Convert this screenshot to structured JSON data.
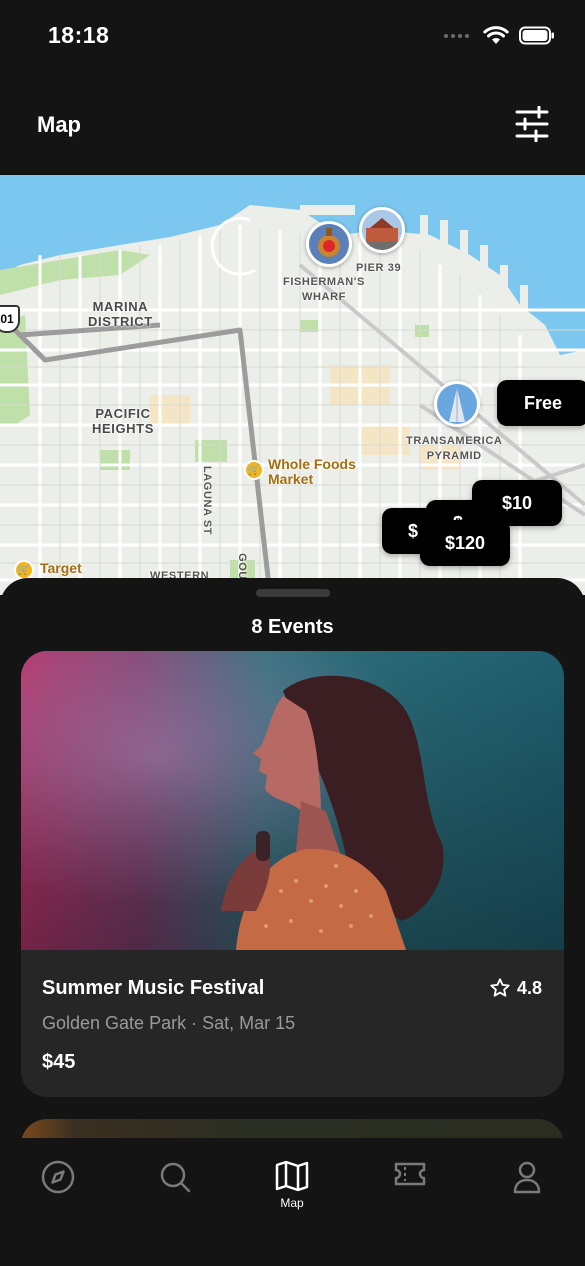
{
  "status": {
    "time": "18:18"
  },
  "header": {
    "title": "Map",
    "filter_icon": "sliders-icon"
  },
  "map": {
    "districts": [
      "MARINA\nDISTRICT",
      "PACIFIC\nHEIGHTS"
    ],
    "landmarks": [
      "FISHERMAN'S\nWHARF",
      "PIER 39",
      "TRANSAMERICA\nPYRAMID"
    ],
    "pois": [
      "Whole Foods\nMarket",
      "Target"
    ],
    "streets": [
      "LAGUNA ST",
      "WESTERN",
      "GOU"
    ],
    "highway_shield": "01",
    "price_pins": [
      "Free",
      "$10",
      "$120",
      "$",
      "$"
    ]
  },
  "sheet": {
    "title": "8 Events"
  },
  "event": {
    "title": "Summer Music Festival",
    "rating": "4.8",
    "meta": "Golden Gate Park · Sat, Mar 15",
    "price": "$45"
  },
  "tabs": [
    {
      "icon": "compass-icon",
      "label": ""
    },
    {
      "icon": "search-icon",
      "label": ""
    },
    {
      "icon": "map-icon",
      "label": "Map",
      "active": true
    },
    {
      "icon": "ticket-icon",
      "label": ""
    },
    {
      "icon": "person-icon",
      "label": ""
    }
  ],
  "colors": {
    "background": "#141414",
    "card": "#262626",
    "water": "#7cc7ef",
    "pin": "#000000"
  }
}
